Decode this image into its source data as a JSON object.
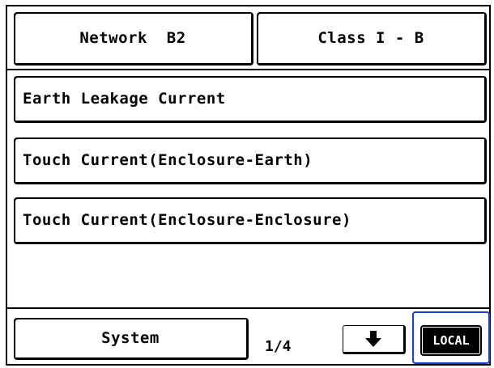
{
  "header": {
    "network_label": "Network  B2",
    "class_label": "Class I - B"
  },
  "measurements": [
    {
      "label": "Earth Leakage Current"
    },
    {
      "label": "Touch Current(Enclosure-Earth)"
    },
    {
      "label": "Touch Current(Enclosure-Enclosure)"
    }
  ],
  "footer": {
    "system_label": "System",
    "page_indicator": "1/4",
    "next_page_icon": "down-arrow-icon",
    "local_label": "LOCAL"
  },
  "colors": {
    "highlight": "#1a3fd6",
    "foreground": "#000000",
    "background": "#ffffff"
  }
}
